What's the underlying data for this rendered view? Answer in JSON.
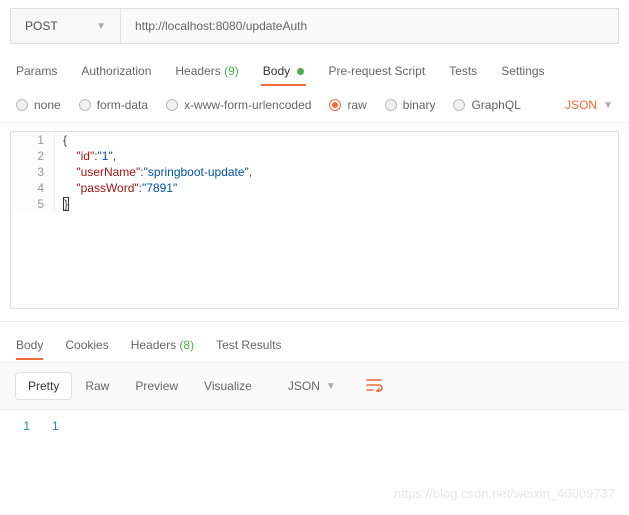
{
  "request": {
    "method": "POST",
    "url": "http://localhost:8080/updateAuth"
  },
  "tabs": {
    "params": "Params",
    "authorization": "Authorization",
    "headers": "Headers",
    "headers_count": "(9)",
    "body": "Body",
    "prerequest": "Pre-request Script",
    "tests": "Tests",
    "settings": "Settings"
  },
  "bodyType": {
    "none": "none",
    "formdata": "form-data",
    "xwww": "x-www-form-urlencoded",
    "raw": "raw",
    "binary": "binary",
    "graphql": "GraphQL",
    "format": "JSON"
  },
  "editor": {
    "l1": "{",
    "l2_k": "\"id\"",
    "l2_v": "\"1\"",
    "l3_k": "\"userName\"",
    "l3_v": "\"springboot-update\"",
    "l4_k": "\"passWord\"",
    "l4_v": "\"7891\"",
    "l5": "}"
  },
  "response": {
    "tabs": {
      "body": "Body",
      "cookies": "Cookies",
      "headers": "Headers",
      "headers_count": "(8)",
      "test": "Test Results"
    },
    "toolbar": {
      "pretty": "Pretty",
      "raw": "Raw",
      "preview": "Preview",
      "visualize": "Visualize",
      "format": "JSON"
    },
    "body": {
      "line1": "1"
    }
  },
  "watermark": "https://blog.csdn.net/weixin_40009737"
}
